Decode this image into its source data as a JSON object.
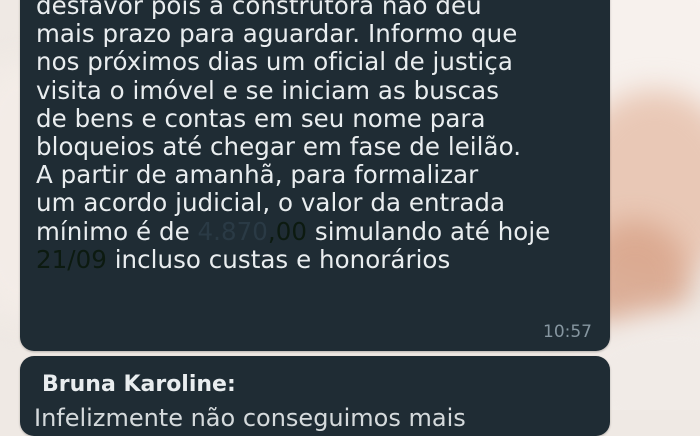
{
  "message": {
    "lines": [
      "desfavor pois a construtora não deu",
      "mais prazo para aguardar. Informo que",
      "nos próximos dias um oficial de justiça",
      "visita o imóvel e se iniciam as buscas",
      "de bens e contas em seu nome para",
      "bloqueios até chegar em fase de leilão.",
      "A partir de amanhã, para formalizar",
      "um acordo judicial, o valor da entrada"
    ],
    "line9_prefix": "mínimo é de ",
    "amount": "4.870",
    "amount_suffix": ",00",
    "line9_rest": " simulando até hoje",
    "date": "21/09",
    "line10_rest": " incluso custas e honorários",
    "time": "10:57"
  },
  "next_message": {
    "sender": "Bruna Karoline:",
    "preview": "Infelizmente não conseguimos mais"
  },
  "colors": {
    "bubble": "#1f2c34",
    "text": "#e9edef",
    "time": "#8696a0"
  }
}
